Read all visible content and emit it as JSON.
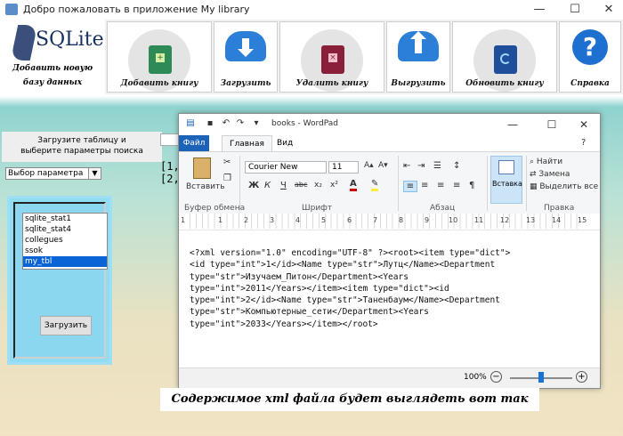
{
  "window": {
    "title": "Добро пожаловать в приложение My library",
    "minimize": "—",
    "maximize": "☐",
    "close": "✕"
  },
  "logo": {
    "brand": "SQLite",
    "line1": "Добавить новую",
    "line2": "базу данных"
  },
  "ribbon": {
    "add_book": "Добавить книгу",
    "upload": "Загрузить",
    "delete_book": "Удалить книгу",
    "export": "Выгрузить",
    "update_book": "Обновить книгу",
    "help": "Справка"
  },
  "left": {
    "info": [
      "Загрузите таблицу и",
      "выберите параметры поиска"
    ],
    "select_value": "Выбор параметра",
    "tables": [
      "sqlite_stat1",
      "sqlite_stat4",
      "collegues",
      "ssok",
      "my_tbl"
    ],
    "selected_table": "my_tbl",
    "load_button": "Загрузить"
  },
  "background_output": [
    "[1, '",
    "[2, '"
  ],
  "wordpad": {
    "title": "books - WordPad",
    "tabs": {
      "file": "Файл",
      "home": "Главная",
      "view": "Вид"
    },
    "font_name": "Courier New",
    "font_size": "11",
    "groups": {
      "clipboard": "Буфер обмена",
      "font": "Шрифт",
      "paragraph": "Абзац",
      "edit": "Правка"
    },
    "paste": "Вставить",
    "insert": "Вставка",
    "find": "Найти",
    "replace": "Замена",
    "select_all": "Выделить все",
    "format_buttons": [
      "Ж",
      "К",
      "Ч",
      "abc",
      "x₂",
      "x²"
    ],
    "ruler_numbers": [
      "1",
      "1",
      "2",
      "3",
      "4",
      "5",
      "6",
      "7",
      "8",
      "9",
      "10",
      "11",
      "12",
      "13",
      "14",
      "15"
    ],
    "document": "<?xml version=\"1.0\" encoding=\"UTF-8\" ?><root><item type=\"dict\">\n<id type=\"int\">1</id><Name type=\"str\">Лутц</Name><Department\ntype=\"str\">Изучаем_Питон</Department><Years\ntype=\"int\">2011</Years></item><item type=\"dict\"><id\ntype=\"int\">2</id><Name type=\"str\">Таненбаум</Name><Department\ntype=\"str\">Компьютерные_сети</Department><Years\ntype=\"int\">2033</Years></item></root>",
    "zoom": "100%",
    "zoom_fraction": 0.5
  },
  "caption": "Содержимое xml файла будет выглядеть вот так",
  "colors": {
    "file_tab": "#1c62b9",
    "list_selection": "#0a64d6",
    "panel": "#8fdcf3"
  }
}
